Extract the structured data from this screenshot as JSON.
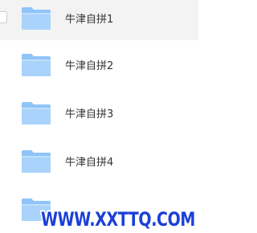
{
  "list": {
    "items": [
      {
        "label": "牛津自拼1",
        "selected": true,
        "icon": "folder-icon"
      },
      {
        "label": "牛津自拼2",
        "selected": false,
        "icon": "folder-icon"
      },
      {
        "label": "牛津自拼3",
        "selected": false,
        "icon": "folder-icon"
      },
      {
        "label": "牛津自拼4",
        "selected": false,
        "icon": "folder-icon"
      },
      {
        "label": "",
        "selected": false,
        "icon": "folder-icon"
      }
    ]
  },
  "watermark": {
    "text": "WWW.XXTTQ.COM",
    "color": "#1b3fd8"
  },
  "colors": {
    "folder_light": "#a7d2fb",
    "folder_dark": "#6fb3f4",
    "selected_row": "#f3f3f3"
  }
}
